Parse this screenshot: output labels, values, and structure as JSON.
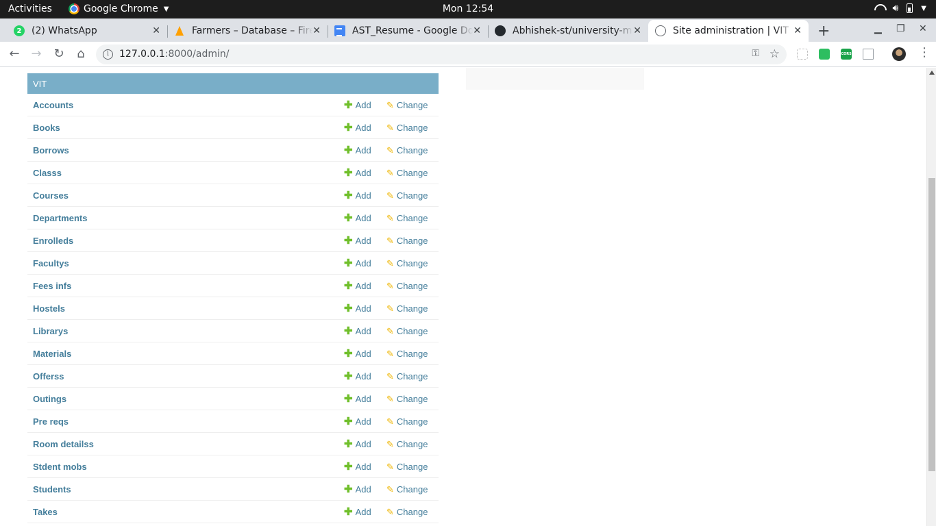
{
  "system_bar": {
    "activities": "Activities",
    "app_name": "Google Chrome",
    "clock": "Mon 12:54"
  },
  "browser": {
    "tabs": [
      {
        "title": "(2) WhatsApp",
        "favicon": "whatsapp-icon",
        "badge": "2"
      },
      {
        "title": "Farmers – Database – Fire",
        "favicon": "firebase-icon"
      },
      {
        "title": "AST_Resume - Google Do",
        "favicon": "google-docs-icon"
      },
      {
        "title": "Abhishek-st/university-m",
        "favicon": "github-icon"
      },
      {
        "title": "Site administration | VIT",
        "favicon": "globe-icon",
        "active": true
      }
    ],
    "address": {
      "host": "127.0.0.1",
      "path": ":8000/admin/"
    },
    "extensions": [
      "extension-icon",
      "evernote-icon",
      "cors-icon",
      "page-icon"
    ],
    "extension_label_cors": "CORS"
  },
  "admin": {
    "app_caption": "VIT",
    "add_label": "Add",
    "change_label": "Change",
    "models": [
      "Accounts",
      "Books",
      "Borrows",
      "Classs",
      "Courses",
      "Departments",
      "Enrolleds",
      "Facultys",
      "Fees infs",
      "Hostels",
      "Librarys",
      "Materials",
      "Offerss",
      "Outings",
      "Pre reqs",
      "Room detailss",
      "Stdent mobs",
      "Students",
      "Takes"
    ]
  },
  "colors": {
    "module_caption": "#79aec8",
    "link": "#447e9b",
    "add_icon": "#70bf2b",
    "change_icon": "#efb80b"
  }
}
